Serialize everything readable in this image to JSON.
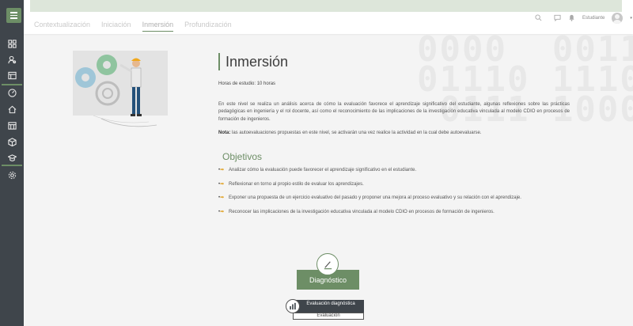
{
  "tabs": [
    {
      "label": "Contextualización",
      "active": false
    },
    {
      "label": "Iniciación",
      "active": false
    },
    {
      "label": "Inmersión",
      "active": true
    },
    {
      "label": "Profundización",
      "active": false
    }
  ],
  "user": {
    "name": "Estudiante",
    "caret": "▾"
  },
  "icons": {
    "sidebar": [
      "dashboard-icon",
      "user-search-icon",
      "book-icon",
      "speedometer-icon",
      "home-icon",
      "calendar-icon",
      "box-icon",
      "graduation-icon",
      "settings-icon"
    ],
    "topbar": [
      "search-icon",
      "chat-icon",
      "bell-icon"
    ]
  },
  "colors": {
    "accent": "#6d8e66",
    "sidebar": "#3f454b",
    "bullet_arrow": "#e0a020"
  },
  "page": {
    "title": "Inmersión",
    "hours": "Horas de estudio: 10 horas",
    "description": "En este nivel se realiza un análisis acerca de cómo la evaluación favorece el aprendizaje significativo del estudiante, algunas reflexiones sobre las prácticas pedagógicas en ingeniería y el rol docente, así como el reconocimiento de las implicaciones de la investigación educativa vinculada al modelo CDIO en procesos de formación de ingenieros.",
    "note_label": "Nota:",
    "note_text": " las autoevaluaciones propuestas en este nivel, se activarán una vez realice la actividad en la cual debe autoevaluarse.",
    "objectives_title": "Objetivos",
    "objectives": [
      "Analizar cómo la evaluación puede favorecer el aprendizaje significativo en el estudiante.",
      "Reflexionar en torno al propio estilo de evaluar los aprendizajes.",
      "Exponer una propuesta de un ejercicio evaluativo del pasado y proponer una mejora al proceso evaluativo y su relación con el aprendizaje.",
      "Reconocer las implicaciones de la investigación educativa vinculada al modelo CDIO en procesos de formación de ingenieros."
    ],
    "diagnostic_button": "Diagnóstico",
    "eval_card": {
      "title": "Evaluación diagnóstica",
      "subtitle": "Evaluación"
    }
  }
}
